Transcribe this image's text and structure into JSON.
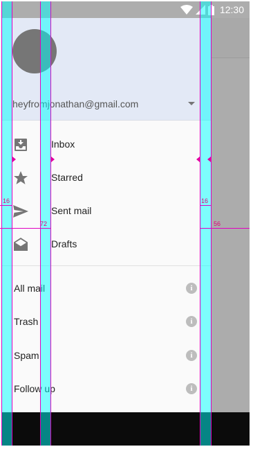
{
  "status_bar": {
    "time": "12:30"
  },
  "account": {
    "email": "heyfromjonathan@gmail.com"
  },
  "nav": [
    {
      "label": "Inbox",
      "icon": "inbox-icon"
    },
    {
      "label": "Starred",
      "icon": "star-icon"
    },
    {
      "label": "Sent mail",
      "icon": "send-icon"
    },
    {
      "label": "Drafts",
      "icon": "drafts-icon"
    }
  ],
  "labels": [
    {
      "label": "All mail",
      "icon": "info-icon"
    },
    {
      "label": "Trash",
      "icon": "info-icon"
    },
    {
      "label": "Spam",
      "icon": "info-icon"
    },
    {
      "label": "Follow up",
      "icon": "info-icon"
    }
  ],
  "info_glyph": "i",
  "keylines": {
    "left_margin": "16",
    "content_offset": "72",
    "right_margin": "16",
    "scrim_width": "56"
  },
  "colors": {
    "header": "#e3e9f6",
    "drawer": "#fafafa",
    "scrim": "#acacac",
    "keyline_overlay": "#00ffff",
    "keyline_marker": "#e000c0"
  }
}
